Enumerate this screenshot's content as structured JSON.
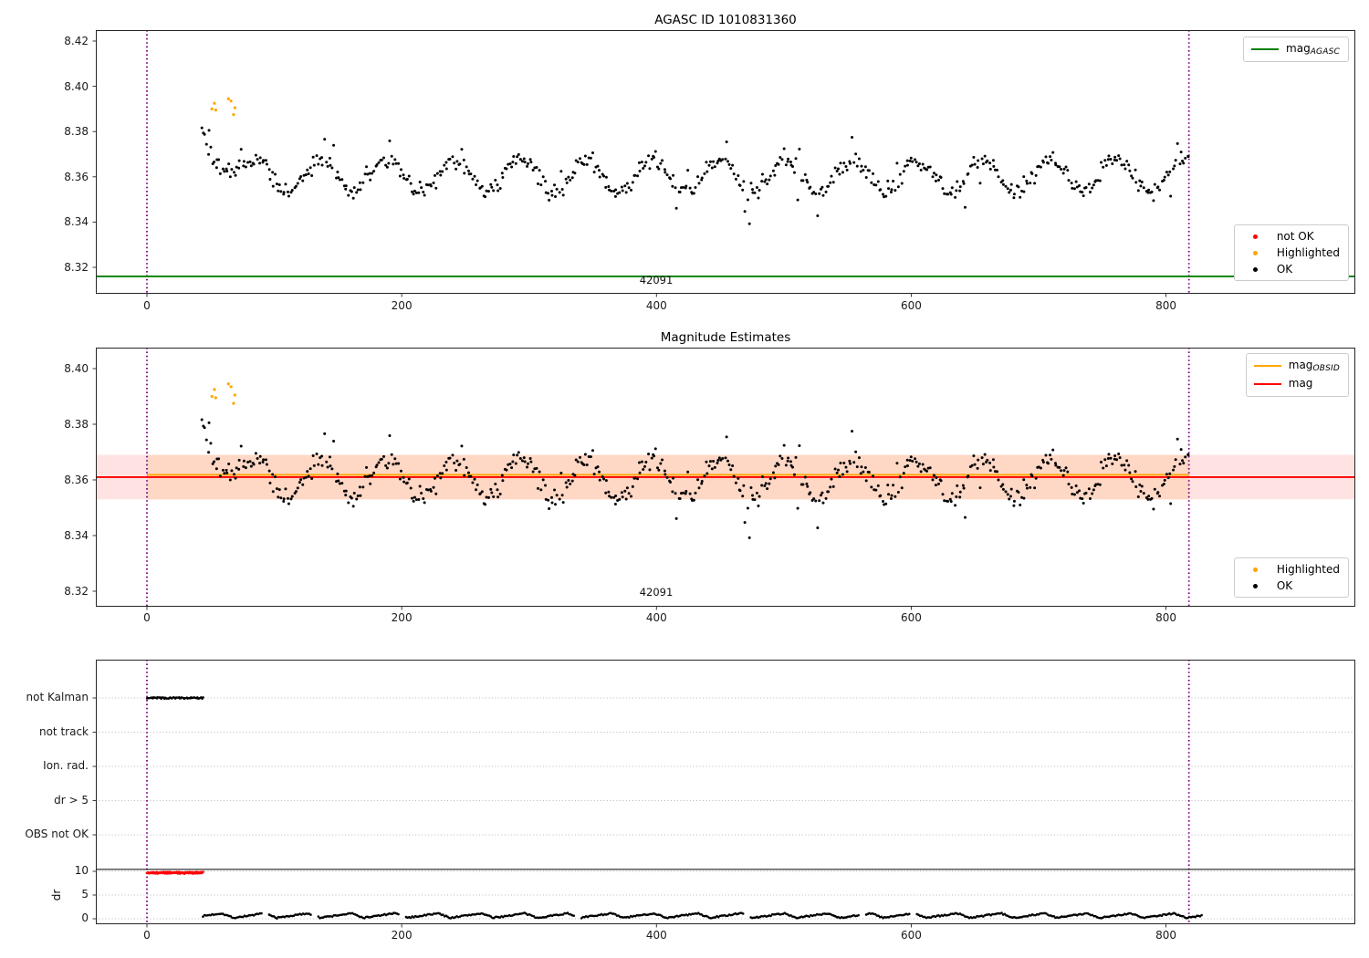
{
  "colors": {
    "green": "#008000",
    "orange": "#ffa500",
    "red": "#ff0000",
    "purple": "#800080",
    "black": "#000000",
    "grid": "#b8b8b8",
    "spine": "#262626",
    "band_red": "rgba(255,0,0,0.11)",
    "band_orange": "rgba(255,140,0,0.13)"
  },
  "chart_data": [
    {
      "type": "scatter",
      "panel": "top",
      "title": "AGASC ID 1010831360",
      "xlim": [
        -40,
        948
      ],
      "ylim": [
        8.308,
        8.425
      ],
      "xticks": [
        0,
        200,
        400,
        600,
        800
      ],
      "yticks": [
        8.42,
        8.4,
        8.38,
        8.36,
        8.34,
        8.32
      ],
      "grid": false,
      "legend_top": [
        {
          "label_main": "mag",
          "label_sub": "AGASC",
          "type": "line",
          "color": "#008000"
        }
      ],
      "legend_bottom": [
        {
          "label": "not OK",
          "color": "#ff0000"
        },
        {
          "label": "Highlighted",
          "color": "#ffa500"
        },
        {
          "label": "OK",
          "color": "#000000"
        }
      ],
      "hline_mag_agasc": 8.316,
      "vlines_obsid_x": [
        0,
        818
      ],
      "obsid_annotation": {
        "text": "42091",
        "x": 400,
        "y": 8.314
      },
      "series": [
        {
          "name": "OK",
          "color": "#000000",
          "marker_px": 1.5,
          "approximated": true,
          "gen": {
            "seed": 42,
            "n": 620,
            "x_start": 43,
            "x_end": 818,
            "base": 8.3605,
            "wave_amp": 0.0072,
            "wave_period": 52,
            "wave_phase": 20,
            "noise": 0.0055,
            "init_boost_until": 80,
            "init_boost_max": 0.017,
            "outlier_drop_p": 0.02,
            "outlier_drop": 0.013,
            "spike_up_p": 0.03,
            "spike_up": 0.008,
            "y_min": 8.338,
            "y_max": 8.396,
            "x_jitter": 1.2
          }
        },
        {
          "name": "Highlighted",
          "color": "#ffa500",
          "marker_px": 1.6,
          "points": [
            [
              51,
              8.39
            ],
            [
              53,
              8.3925
            ],
            [
              54,
              8.3895
            ],
            [
              64,
              8.3945
            ],
            [
              66,
              8.3935
            ],
            [
              68,
              8.3875
            ],
            [
              69,
              8.3905
            ]
          ]
        },
        {
          "name": "not OK",
          "color": "#ff0000",
          "marker_px": 1.5,
          "points": []
        }
      ]
    },
    {
      "type": "scatter",
      "panel": "middle",
      "title": "Magnitude Estimates",
      "xlim": [
        -40,
        948
      ],
      "ylim": [
        8.314,
        8.4075
      ],
      "xticks": [
        0,
        200,
        400,
        600,
        800
      ],
      "yticks": [
        8.4,
        8.38,
        8.36,
        8.34,
        8.32
      ],
      "grid": false,
      "legend_top": [
        {
          "label_main": "mag",
          "label_sub": "OBSID",
          "type": "line",
          "color": "#ffa500"
        },
        {
          "label_main": "mag",
          "label_sub": "",
          "type": "line",
          "color": "#ff0000"
        }
      ],
      "legend_bottom": [
        {
          "label": "Highlighted",
          "color": "#ffa500"
        },
        {
          "label": "OK",
          "color": "#000000"
        }
      ],
      "mag_line": 8.361,
      "mag_band": [
        8.353,
        8.369
      ],
      "mag_obsid_line": 8.3615,
      "mag_obsid_band": [
        8.353,
        8.369
      ],
      "mag_obsid_span": [
        0,
        818
      ],
      "vlines_obsid_x": [
        0,
        818
      ],
      "obsid_annotation": {
        "text": "42091",
        "x": 400,
        "y": 8.317
      },
      "series_same_as_panel": "top"
    },
    {
      "type": "scatter",
      "panel": "bottom",
      "xlim": [
        -40,
        948
      ],
      "xticks": [
        0,
        200,
        400,
        600,
        800
      ],
      "categories": [
        "not Kalman",
        "not track",
        "Ion. rad.",
        "dr > 5",
        "OBS not OK"
      ],
      "dr_axis": {
        "label": "dr",
        "ticks": [
          10,
          5,
          0
        ],
        "ylim": [
          -1.2,
          10.4
        ]
      },
      "grid": true,
      "hline_solid_at_dr": 10.4,
      "vlines_obsid_x": [
        0,
        818
      ],
      "series": [
        {
          "name": "not Kalman flags",
          "color": "#000000",
          "marker_px": 1.3,
          "category_index": 0,
          "gen": {
            "seed": 5,
            "n": 52,
            "x_start": 0,
            "x_end": 44
          }
        },
        {
          "name": "dr clipped not OK",
          "color": "#ff0000",
          "marker_px": 1.4,
          "gen": {
            "seed": 3,
            "n": 52,
            "x_start": 0,
            "x_end": 44,
            "base": 9.5,
            "step_alt": 0.22,
            "noise": 0.18
          }
        },
        {
          "name": "dr",
          "color": "#000000",
          "marker_px": 1.3,
          "approximated": true,
          "gen": {
            "seed": 7,
            "n": 650,
            "x_start": 44,
            "x_end": 828,
            "period": 34,
            "base": 0.2,
            "amp": 0.95,
            "noise": 0.28,
            "gap_p": 0.012
          }
        }
      ]
    }
  ]
}
